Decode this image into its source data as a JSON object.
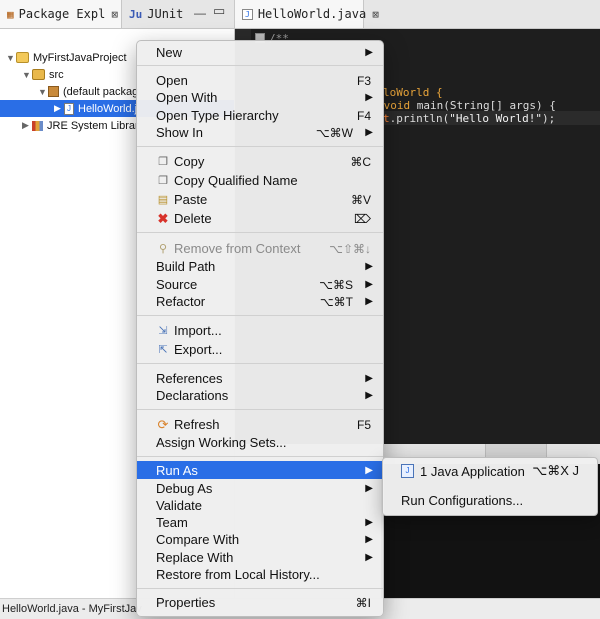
{
  "package_explorer": {
    "tab_label": "Package Expl",
    "junit_tab_label": "JUnit",
    "tree": {
      "project": "MyFirstJavaProject",
      "src": "src",
      "package": "(default packag",
      "file": "HelloWorld.j",
      "jre": "JRE System Librar"
    }
  },
  "editor": {
    "tab_label": "HelloWorld.java",
    "code_lines": {
      "l1": "/**",
      "l2_class": "loWorld {",
      "l3_kw": " void",
      "l3_rest": " main(String[] args) {",
      "l4_field": "t",
      "l4_rest": ".println(",
      "l4_str": "\"Hello World!\"",
      "l4_end": ");"
    }
  },
  "status_bar": {
    "text": "HelloWorld.java - MyFirstJav"
  },
  "context_menu": {
    "items": {
      "new": "New",
      "open": "Open",
      "open_sc": "F3",
      "open_with": "Open With",
      "open_type_hierarchy": "Open Type Hierarchy",
      "open_type_hierarchy_sc": "F4",
      "show_in": "Show In",
      "show_in_sc": "⌥⌘W",
      "copy": "Copy",
      "copy_sc": "⌘C",
      "copy_qualified": "Copy Qualified Name",
      "paste": "Paste",
      "paste_sc": "⌘V",
      "delete": "Delete",
      "delete_sc": "⌦",
      "remove_from_context": "Remove from Context",
      "remove_from_context_sc": "⌥⇧⌘↓",
      "build_path": "Build Path",
      "source": "Source",
      "source_sc": "⌥⌘S",
      "refactor": "Refactor",
      "refactor_sc": "⌥⌘T",
      "import": "Import...",
      "export": "Export...",
      "references": "References",
      "declarations": "Declarations",
      "refresh": "Refresh",
      "refresh_sc": "F5",
      "assign_working_sets": "Assign Working Sets...",
      "run_as": "Run As",
      "debug_as": "Debug As",
      "validate": "Validate",
      "team": "Team",
      "compare_with": "Compare With",
      "replace_with": "Replace With",
      "restore_local_history": "Restore from Local History...",
      "properties": "Properties",
      "properties_sc": "⌘I"
    }
  },
  "run_as_submenu": {
    "java_app": "1 Java Application",
    "java_app_sc": "⌥⌘X J",
    "run_configurations": "Run Configurations..."
  },
  "colors": {
    "selection": "#2a6ee6",
    "editor_bg": "#1e1e1e",
    "console_bg": "#121212"
  }
}
